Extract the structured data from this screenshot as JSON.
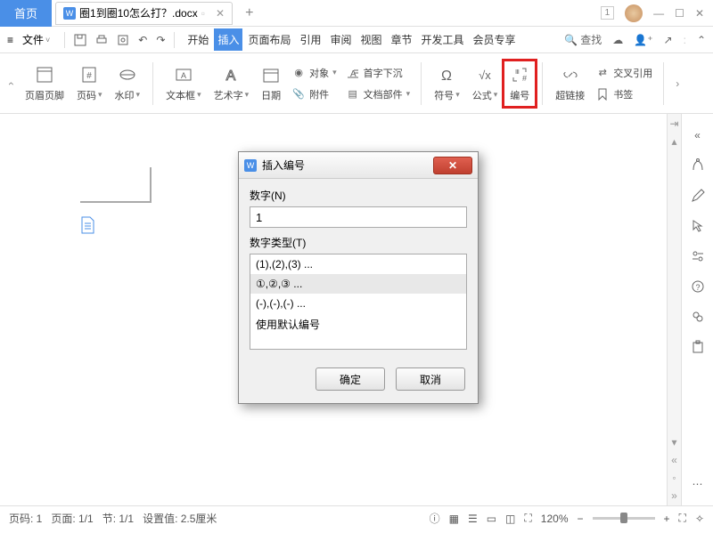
{
  "titlebar": {
    "home": "首页",
    "doc_name": "圈1到圈10怎么打？.docx",
    "new_tab_icon": "+",
    "window_badge": "1"
  },
  "menubar": {
    "file": "文件",
    "menus": [
      "开始",
      "插入",
      "页面布局",
      "引用",
      "审阅",
      "视图",
      "章节",
      "开发工具",
      "会员专享"
    ],
    "active_index": 1,
    "search": "查找"
  },
  "ribbon": {
    "header_footer": "页眉页脚",
    "page_number": "页码",
    "watermark": "水印",
    "textbox": "文本框",
    "wordart": "艺术字",
    "date": "日期",
    "object": "对象",
    "caps": "首字下沉",
    "attachment": "附件",
    "doc_parts": "文档部件",
    "symbol": "符号",
    "formula": "公式",
    "number": "编号",
    "hyperlink": "超链接",
    "cross_ref": "交叉引用",
    "bookmark": "书签"
  },
  "dialog": {
    "title": "插入编号",
    "label_number": "数字(N)",
    "input_value": "1",
    "label_type": "数字类型(T)",
    "options": [
      "(1),(2),(3) ...",
      "①,②,③ ...",
      "(-),(-),(-) ...",
      "使用默认编号"
    ],
    "selected_index": 1,
    "ok": "确定",
    "cancel": "取消"
  },
  "statusbar": {
    "page_num": "页码: 1",
    "page": "页面: 1/1",
    "section": "节: 1/1",
    "setting": "设置值: 2.5厘米",
    "zoom": "120%"
  }
}
